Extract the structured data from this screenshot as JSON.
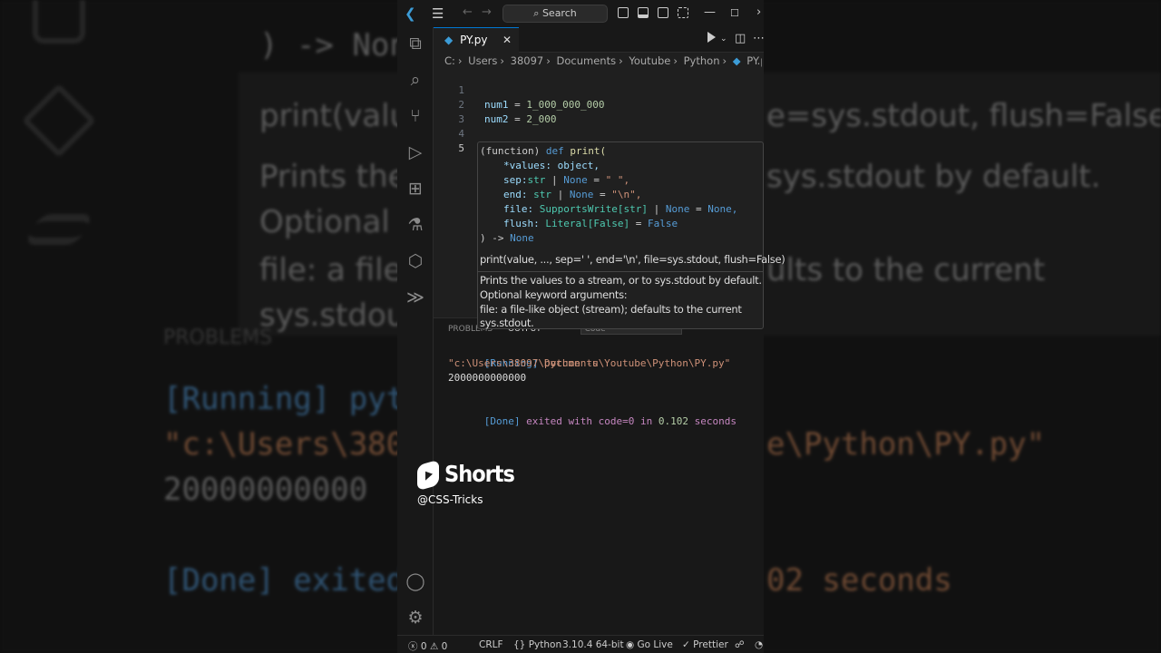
{
  "background": {
    "code_print": "print(valu",
    "code_prints": "Prints the",
    "code_optional": "Optional",
    "code_file": "file: a file-",
    "code_stdout": "sys.stdout",
    "code_none": ") -> None",
    "right_sig": "e=sys.stdout, flush=False)",
    "right_prints": "sys.stdout by default.",
    "right_file": "ults to the current",
    "problems": "PROBLEMS",
    "running": "[Running] pyt",
    "path": "\"c:\\Users\\380",
    "result": "20000000000",
    "done": "[Done] exited",
    "right_path": "e\\Python\\PY.py\"",
    "right_seconds": "02 seconds"
  },
  "titlebar": {
    "search_label": "Search",
    "back_label": "←",
    "forward_label": "→"
  },
  "tab": {
    "filename": "PY.py"
  },
  "breadcrumb": [
    "C:",
    "Users",
    "38097",
    "Documents",
    "Youtube",
    "Python",
    "PY.py",
    "..."
  ],
  "code_lines": [
    {
      "n": "1"
    },
    {
      "n": "2"
    },
    {
      "n": "3"
    },
    {
      "n": "4"
    },
    {
      "n": "5"
    }
  ],
  "hover": {
    "sig_function": "(function)",
    "sig_def": "def",
    "sig_print": "print(",
    "values": "*values: object,",
    "sep_name": "sep:",
    "sep_type": "str",
    "sep_none": "None",
    "sep_default": "\" \",",
    "end_name": "end:",
    "end_type": "str",
    "end_none": "None",
    "end_default": "\"\\n\",",
    "file_name": "file:",
    "file_type": "SupportsWrite[str]",
    "file_none": "None",
    "file_default": "None,",
    "flush_name": "flush:",
    "flush_type": "Literal[False]",
    "flush_default": "False",
    "ret": ") ->",
    "ret_none": "None",
    "signature": "print(value, ..., sep=' ', end='\\n', file=sys.stdout, flush=False)",
    "doc1": "Prints the values to a stream, or to sys.stdout by default.",
    "doc2": "Optional keyword arguments:",
    "doc3": "file: a file-like object (stream); defaults to the current",
    "doc4": "sys.stdout."
  },
  "panel": {
    "tab_problems": "PROBLEMS",
    "tab_output": "OUTPUT",
    "channel": "Code",
    "running_tag": "[Running]",
    "running_cmd": "python -u",
    "running_path": "\"c:\\Users\\38097\\Documents\\Youtube\\Python\\PY.py\"",
    "result": "2000000000000",
    "done_tag": "[Done]",
    "done_exited": "exited with",
    "done_code": "code=0",
    "done_in": "in",
    "done_time": "0.102",
    "done_seconds": "seconds"
  },
  "overlay": {
    "shorts": "Shorts",
    "handle": "@CSS-Tricks"
  },
  "status": {
    "errors": "0",
    "warnings": "0",
    "eol": "CRLF",
    "language": "Python",
    "interpreter": "3.10.4 64-bit",
    "golive": "Go Live",
    "prettier": "Prettier"
  },
  "colors": {
    "accent": "#0078d4",
    "keyword": "#569cd6",
    "variable": "#9cdcfe",
    "number": "#b5cea8",
    "string": "#ce9178"
  }
}
